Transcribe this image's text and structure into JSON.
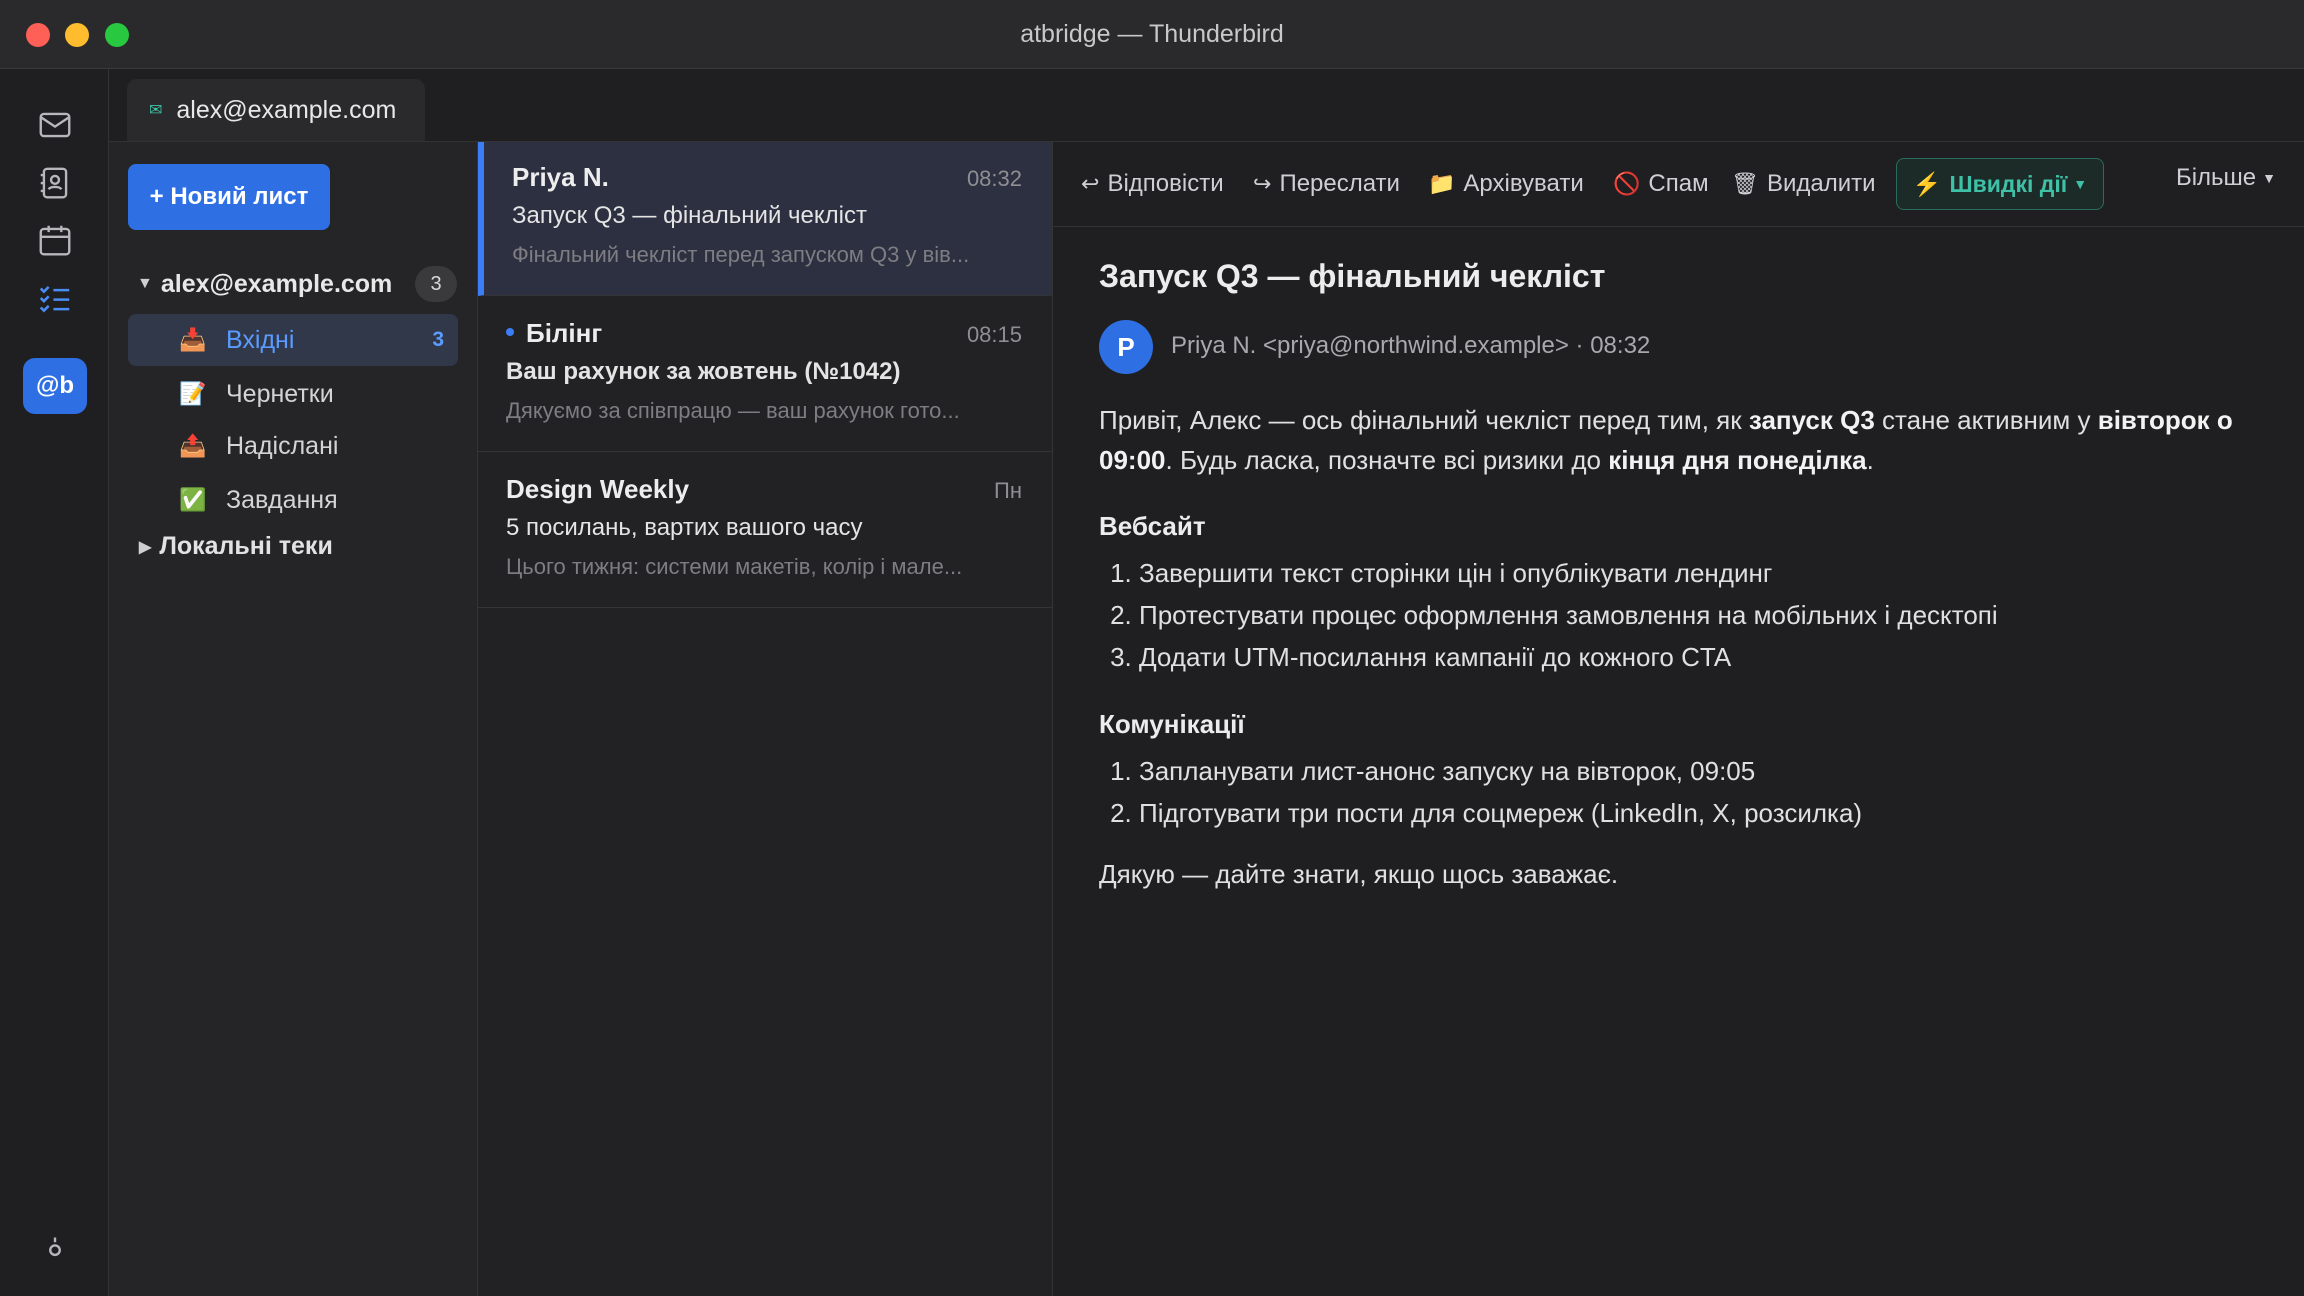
{
  "window": {
    "title": "atbridge — Thunderbird"
  },
  "tab": {
    "label": "alex@example.com"
  },
  "folders": {
    "new_message": "+ Новий лист",
    "account": {
      "name": "alex@example.com",
      "count": "3"
    },
    "items": [
      {
        "label": "Вхідні",
        "count": "3",
        "icon": "inbox-icon"
      },
      {
        "label": "Чернетки",
        "count": "",
        "icon": "drafts-icon"
      },
      {
        "label": "Надіслані",
        "count": "",
        "icon": "sent-icon"
      },
      {
        "label": "Завдання",
        "count": "",
        "icon": "tasks-icon"
      }
    ],
    "local": "Локальні теки"
  },
  "messages": [
    {
      "sender": "Priya N.",
      "time": "08:32",
      "subject": "Запуск Q3 — фінальний чекліст",
      "preview": "Фінальний чекліст перед запуском Q3 у вів..."
    },
    {
      "sender": "Білінг",
      "time": "08:15",
      "subject": "Ваш рахунок за жовтень (№1042)",
      "preview": "Дякуємо за співпрацю — ваш рахунок гото..."
    },
    {
      "sender": "Design Weekly",
      "time": "Пн",
      "subject": "5 посилань, вартих вашого часу",
      "preview": "Цього тижня: системи макетів, колір і мале..."
    }
  ],
  "toolbar": {
    "reply": "Відповісти",
    "forward": "Переслати",
    "archive": "Архівувати",
    "spam": "Спам",
    "delete": "Видалити",
    "quick": "Швидкі дії",
    "more": "Більше"
  },
  "reader": {
    "title": "Запуск Q3 — фінальний чекліст",
    "avatar": "P",
    "from": "Priya N. <priya@northwind.example> · 08:32",
    "intro": {
      "a": "Привіт, Алекс — ось фінальний чекліст перед тим, як ",
      "b": "запуск Q3",
      "c": " стане активним у ",
      "d": "вівторок о 09:00",
      "e": ". Будь ласка, позначте всі ризики до ",
      "f": "кінця дня понеділка",
      "g": "."
    },
    "section1": {
      "heading": "Вебсайт",
      "items": [
        "Завершити текст сторінки цін і опублікувати лендинг",
        "Протестувати процес оформлення замовлення на мобільних і десктопі",
        "Додати UTM-посилання кампанії до кожного CTA"
      ]
    },
    "section2": {
      "heading": "Комунікації",
      "items": [
        "Запланувати лист-анонс запуску на вівторок, 09:05",
        "Підготувати три пости для соцмереж (LinkedIn, X, розсилка)"
      ]
    },
    "closing": "Дякую — дайте знати, якщо щось заважає."
  },
  "rail": {
    "badge": "@b"
  }
}
